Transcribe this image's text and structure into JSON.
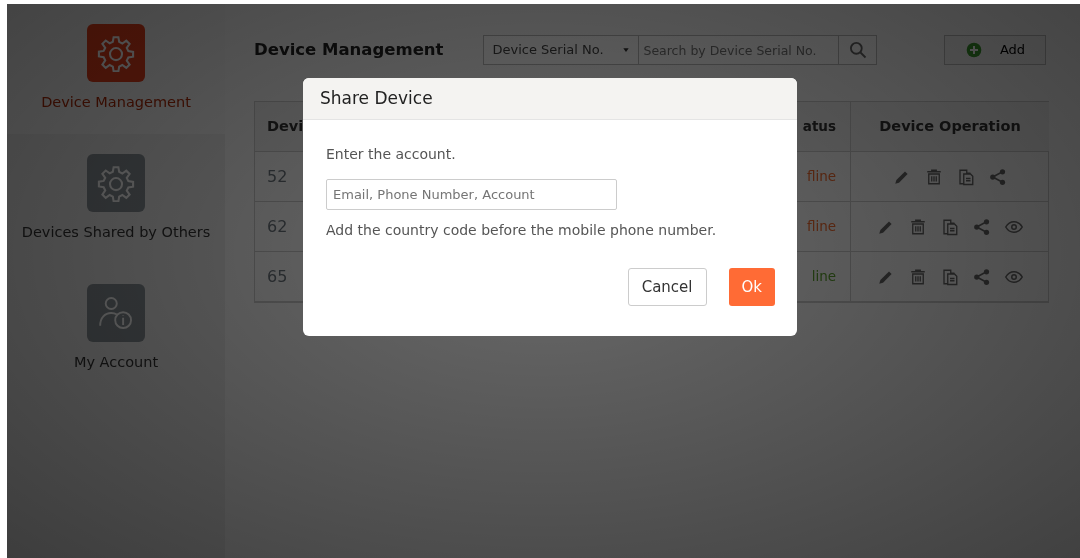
{
  "sidebar": {
    "items": [
      {
        "label": "Device Management",
        "kind": "gear",
        "selected": true
      },
      {
        "label": "Devices Shared by Others",
        "kind": "gear",
        "selected": false
      },
      {
        "label": "My Account",
        "kind": "account",
        "selected": false
      }
    ]
  },
  "header": {
    "title": "Device Management",
    "filter_select": {
      "value": "Device Serial No."
    },
    "search": {
      "placeholder": "Search by Device Serial No."
    },
    "add_button": "Add"
  },
  "table": {
    "columns": [
      {
        "label": "Devi"
      },
      {
        "label": "atus"
      },
      {
        "label": "Device Operation"
      }
    ],
    "rows": [
      {
        "column_1": "52",
        "status": "fline",
        "online": false,
        "operations": [
          {
            "kind": "edit"
          },
          {
            "kind": "delete"
          },
          {
            "kind": "copy"
          },
          {
            "kind": "share"
          }
        ]
      },
      {
        "column_1": "62",
        "status": "fline",
        "online": false,
        "operations": [
          {
            "kind": "edit"
          },
          {
            "kind": "delete"
          },
          {
            "kind": "copy"
          },
          {
            "kind": "share"
          },
          {
            "kind": "view"
          }
        ]
      },
      {
        "column_1": "65",
        "status": "line",
        "online": true,
        "operations": [
          {
            "kind": "edit"
          },
          {
            "kind": "delete"
          },
          {
            "kind": "copy"
          },
          {
            "kind": "share"
          },
          {
            "kind": "view"
          }
        ]
      }
    ]
  },
  "modal": {
    "title": "Share Device",
    "prompt": "Enter the account.",
    "account_field": {
      "placeholder": "Email, Phone Number, Account"
    },
    "hint": "Add the country code before the mobile phone number.",
    "buttons": [
      {
        "label": "Cancel",
        "kind": "secondary"
      },
      {
        "label": "Ok",
        "kind": "primary"
      }
    ]
  }
}
